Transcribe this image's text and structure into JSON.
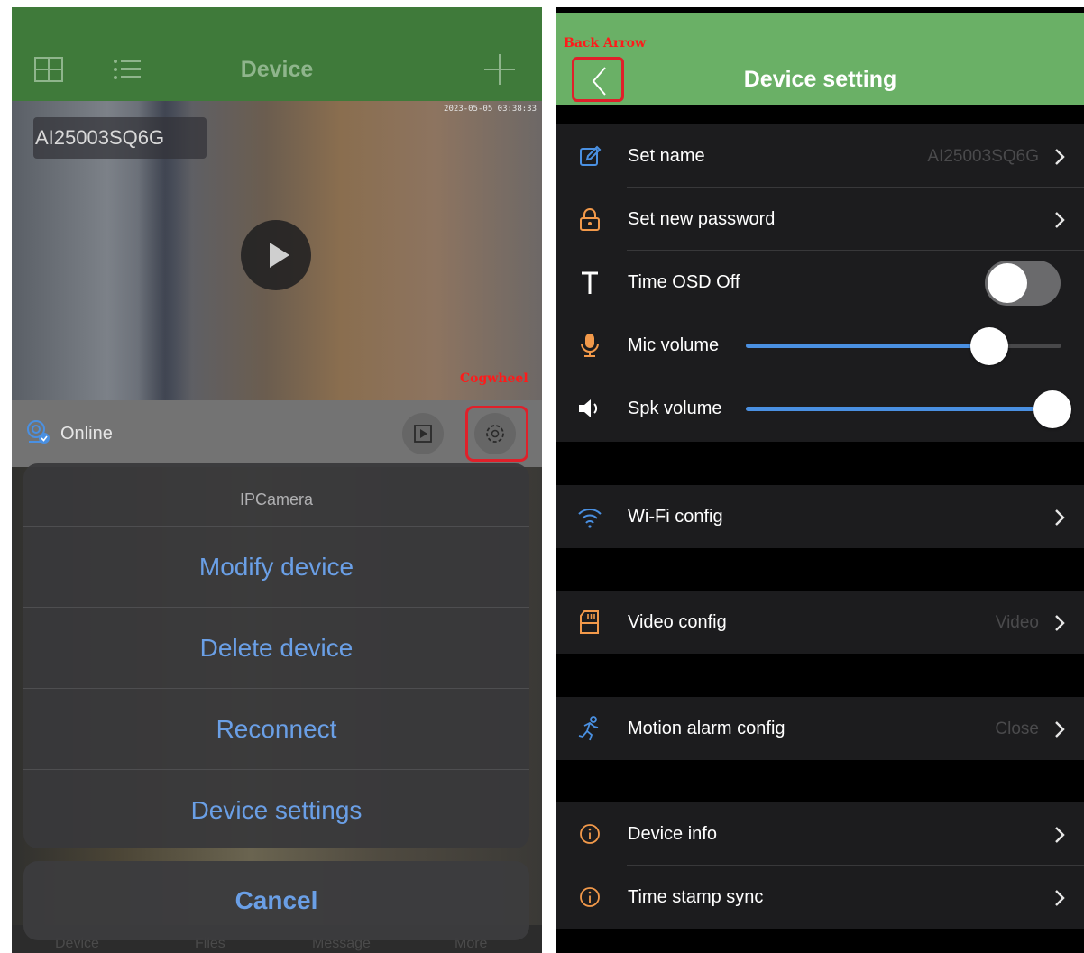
{
  "left_screen": {
    "header": {
      "title": "Device",
      "icons": [
        "grid-view-icon",
        "list-view-icon",
        "add-icon"
      ]
    },
    "video": {
      "device_name": "AI25003SQ6G",
      "timestamp": "2023-05-05 03:38:33",
      "play_icon": "play-icon"
    },
    "status": {
      "label": "Online",
      "icons": [
        "camera-online-icon",
        "playback-icon",
        "gear-icon"
      ]
    },
    "annotation_cogwheel": "Cogwheel",
    "action_sheet": {
      "title": "IPCamera",
      "items": [
        "Modify device",
        "Delete device",
        "Reconnect",
        "Device settings"
      ],
      "cancel": "Cancel"
    },
    "tabs": [
      "Device",
      "Files",
      "Message",
      "More"
    ]
  },
  "right_screen": {
    "header": {
      "title": "Device setting",
      "back_icon": "chevron-left-icon"
    },
    "annotation_back": "Back Arrow",
    "rows": {
      "set_name": {
        "label": "Set name",
        "value": "AI25003SQ6G",
        "icon": "edit-icon"
      },
      "set_password": {
        "label": "Set new password",
        "icon": "lock-icon"
      },
      "time_osd": {
        "label": "Time OSD Off",
        "icon": "text-t-icon",
        "toggle_on": false
      },
      "mic_volume": {
        "label": "Mic volume",
        "icon": "microphone-icon",
        "level": 0.77
      },
      "spk_volume": {
        "label": "Spk volume",
        "icon": "speaker-icon",
        "level": 1.0
      },
      "wifi": {
        "label": "Wi-Fi config",
        "icon": "wifi-icon"
      },
      "video": {
        "label": "Video config",
        "value": "Video",
        "icon": "sd-card-icon"
      },
      "motion": {
        "label": "Motion alarm config",
        "value": "Close",
        "icon": "running-person-icon"
      },
      "device_info": {
        "label": "Device info",
        "icon": "info-icon"
      },
      "time_sync": {
        "label": "Time stamp sync",
        "icon": "info-icon"
      }
    },
    "colors": {
      "header_green": "#6ab066",
      "accent_blue": "#4a90e2",
      "icon_orange": "#f2994a",
      "highlight_red": "#e0202a"
    }
  }
}
